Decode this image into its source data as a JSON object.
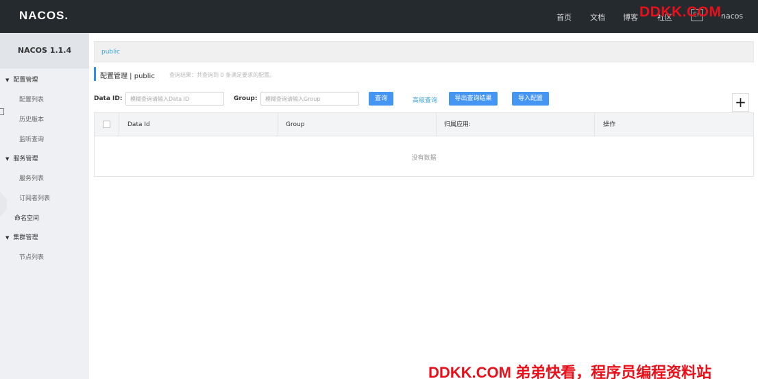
{
  "header": {
    "logo": "NACOS.",
    "nav": [
      "首页",
      "文档",
      "博客",
      "社区"
    ],
    "lang": "En",
    "user": "nacos",
    "watermark": "DDKK.COM"
  },
  "sidebar": {
    "title": "NACOS 1.1.4",
    "groups": [
      {
        "label": "配置管理",
        "items": [
          "配置列表",
          "历史版本",
          "监听查询"
        ]
      },
      {
        "label": "服务管理",
        "items": [
          "服务列表",
          "订阅者列表"
        ]
      },
      {
        "label": "命名空间"
      },
      {
        "label": "集群管理",
        "items": [
          "节点列表"
        ]
      }
    ]
  },
  "main": {
    "breadcrumb": "public",
    "title": "配置管理  |  public",
    "result": "查询结果：共查询到 0 条满足要求的配置。",
    "search": {
      "dataid_label": "Data ID:",
      "dataid_placeholder": "模糊查询请输入Data ID",
      "group_label": "Group:",
      "group_placeholder": "模糊查询请输入Group",
      "query_button": "查询",
      "advanced_link": "高级查询",
      "export_button": "导出查询结果",
      "import_button": "导入配置",
      "add_button": "+"
    },
    "table": {
      "columns": [
        "Data Id",
        "Group",
        "归属应用:",
        "操作"
      ],
      "empty_text": "没有数据"
    }
  },
  "footer_watermark": "DDKK.COM 弟弟快看，程序员编程资料站"
}
